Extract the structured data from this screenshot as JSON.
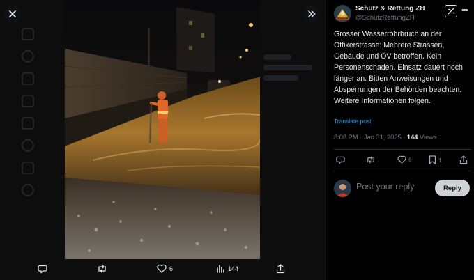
{
  "viewer": {
    "icons": {
      "close": "close-icon",
      "expand": "chevrons-right-icon"
    },
    "actions": {
      "reply": {
        "icon": "reply-icon",
        "count": ""
      },
      "repost": {
        "icon": "repost-icon",
        "count": ""
      },
      "like": {
        "icon": "like-icon",
        "count": "6"
      },
      "views": {
        "icon": "views-icon",
        "count": "144"
      },
      "share": {
        "icon": "share-icon",
        "count": ""
      }
    }
  },
  "post": {
    "author_name": "Schutz & Rettung ZH",
    "author_handle": "@SchutzRettungZH",
    "text": "Grosser Wasserrohrbruch an der Ottikerstrasse: Mehrere Strassen, Gebäude und ÖV betroffen. Kein Personenschaden. Einsatz dauert noch länger an. Bitten Anweisungen und Absperrungen der Behörden beachten. Weitere Informationen folgen.",
    "translate_label": "Translate post",
    "timestamp": "8:08 PM · Jan 31, 2025 · ",
    "views_count": "144",
    "views_label": " Views",
    "stats": {
      "replies": "",
      "reposts": "",
      "likes": "6",
      "bookmarks": "1"
    },
    "reply_placeholder": "Post your reply",
    "reply_button": "Reply"
  },
  "colors": {
    "background": "#000000",
    "accent": "#1d9bf0",
    "muted": "#71767b",
    "text": "#e7e9ea",
    "reply_button_bg": "#cfd2d4"
  }
}
